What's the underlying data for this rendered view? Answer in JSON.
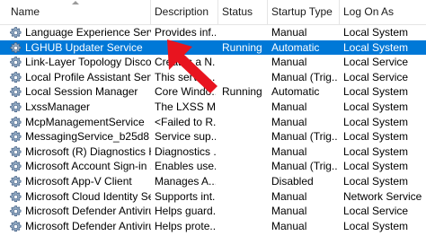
{
  "columns": {
    "name": "Name",
    "description": "Description",
    "status": "Status",
    "startup_type": "Startup Type",
    "log_on_as": "Log On As"
  },
  "services": [
    {
      "name": "Language Experience Service",
      "description": "Provides inf...",
      "status": "",
      "startup_type": "Manual",
      "log_on_as": "Local System"
    },
    {
      "name": "LGHUB Updater Service",
      "description": "",
      "status": "Running",
      "startup_type": "Automatic",
      "log_on_as": "Local System",
      "selected": true
    },
    {
      "name": "Link-Layer Topology Discov...",
      "description": "Creates a N...",
      "status": "",
      "startup_type": "Manual",
      "log_on_as": "Local Service"
    },
    {
      "name": "Local Profile Assistant Service",
      "description": "This servic...",
      "status": "",
      "startup_type": "Manual (Trig...",
      "log_on_as": "Local Service"
    },
    {
      "name": "Local Session Manager",
      "description": "Core Windo...",
      "status": "Running",
      "startup_type": "Automatic",
      "log_on_as": "Local System"
    },
    {
      "name": "LxssManager",
      "description": "The LXSS M...",
      "status": "",
      "startup_type": "Manual",
      "log_on_as": "Local System"
    },
    {
      "name": "McpManagementService",
      "description": "<Failed to R...",
      "status": "",
      "startup_type": "Manual",
      "log_on_as": "Local System"
    },
    {
      "name": "MessagingService_b25d8",
      "description": "Service sup...",
      "status": "",
      "startup_type": "Manual (Trig...",
      "log_on_as": "Local System"
    },
    {
      "name": "Microsoft (R) Diagnostics H...",
      "description": "Diagnostics ...",
      "status": "",
      "startup_type": "Manual",
      "log_on_as": "Local System"
    },
    {
      "name": "Microsoft Account Sign-in ...",
      "description": "Enables use...",
      "status": "",
      "startup_type": "Manual (Trig...",
      "log_on_as": "Local System"
    },
    {
      "name": "Microsoft App-V Client",
      "description": "Manages A...",
      "status": "",
      "startup_type": "Disabled",
      "log_on_as": "Local System"
    },
    {
      "name": "Microsoft Cloud Identity Se...",
      "description": "Supports int...",
      "status": "",
      "startup_type": "Manual",
      "log_on_as": "Network Service"
    },
    {
      "name": "Microsoft Defender Antiviru...",
      "description": "Helps guard...",
      "status": "",
      "startup_type": "Manual",
      "log_on_as": "Local Service"
    },
    {
      "name": "Microsoft Defender Antiviru...",
      "description": "Helps prote...",
      "status": "",
      "startup_type": "Manual",
      "log_on_as": "Local System"
    }
  ],
  "colors": {
    "selection": "#0078d7",
    "arrow": "#e8141f"
  },
  "icons": {
    "service": "gear-icon",
    "sort": "sort-ascending-icon",
    "pointer": "arrow-pointer-annotation"
  }
}
